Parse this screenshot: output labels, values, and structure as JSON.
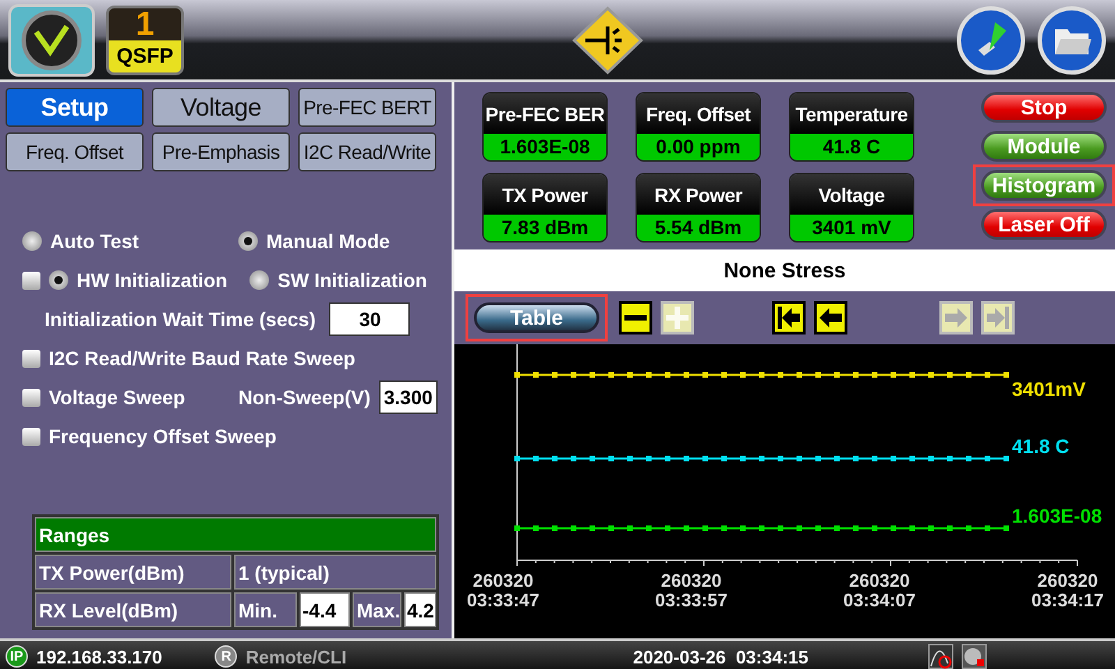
{
  "header": {
    "port_number": "1",
    "port_type": "QSFP"
  },
  "tabs": [
    {
      "label": "Setup",
      "selected": true
    },
    {
      "label": "Voltage",
      "selected": false
    },
    {
      "label": "Pre-FEC BERT",
      "selected": false
    },
    {
      "label": "Freq. Offset",
      "selected": false
    },
    {
      "label": "Pre-Emphasis",
      "selected": false
    },
    {
      "label": "I2C Read/Write",
      "selected": false
    }
  ],
  "mode_options": [
    {
      "label": "Auto Test",
      "selected": false
    },
    {
      "label": "Manual Mode",
      "selected": true
    }
  ],
  "init": {
    "checked": false,
    "options": [
      {
        "label": "HW Initialization",
        "selected": true
      },
      {
        "label": "SW Initialization",
        "selected": false
      }
    ]
  },
  "wait_time": {
    "label": "Initialization Wait Time (secs)",
    "value": "30"
  },
  "sweeps": [
    {
      "label": "I2C Read/Write Baud Rate Sweep",
      "checked": false
    },
    {
      "label": "Voltage Sweep",
      "checked": false
    },
    {
      "label": "Frequency Offset Sweep",
      "checked": false
    }
  ],
  "non_sweep": {
    "label": "Non-Sweep(V)",
    "value": "3.300"
  },
  "ranges": {
    "title": "Ranges",
    "tx_label": "TX Power(dBm)",
    "tx_value": "1 (typical)",
    "rx_label": "RX Level(dBm)",
    "min_label": "Min.",
    "min_value": "-4.4",
    "max_label": "Max.",
    "max_value": "4.2"
  },
  "metrics": [
    {
      "label": "Pre-FEC BER",
      "value": "1.603E-08"
    },
    {
      "label": "Freq. Offset",
      "value": "0.00 ppm"
    },
    {
      "label": "Temperature",
      "value": "41.8 C"
    },
    {
      "label": "TX Power",
      "value": "7.83 dBm"
    },
    {
      "label": "RX Power",
      "value": "5.54 dBm"
    },
    {
      "label": "Voltage",
      "value": "3401 mV"
    }
  ],
  "actions": [
    {
      "label": "Stop",
      "kind": "danger",
      "highlighted": false
    },
    {
      "label": "Module",
      "kind": "normal",
      "highlighted": false
    },
    {
      "label": "Histogram",
      "kind": "normal",
      "highlighted": true
    },
    {
      "label": "Laser Off",
      "kind": "danger",
      "highlighted": false
    }
  ],
  "stress_label": "None Stress",
  "toolbar": {
    "table_button": {
      "label": "Table",
      "highlighted": true
    },
    "buttons": [
      {
        "kind": "minus",
        "disabled": false
      },
      {
        "kind": "plus",
        "disabled": true
      },
      {
        "kind": "first",
        "disabled": false
      },
      {
        "kind": "prev",
        "disabled": false
      },
      {
        "kind": "next",
        "disabled": true
      },
      {
        "kind": "last",
        "disabled": true
      }
    ]
  },
  "chart": {
    "series": [
      {
        "label": "3401mV",
        "color": "#f0e000"
      },
      {
        "label": "41.8 C",
        "color": "#00e0f0"
      },
      {
        "label": "1.603E-08",
        "color": "#00e000"
      }
    ],
    "x_labels": [
      {
        "date": "260320",
        "time": "03:33:47"
      },
      {
        "date": "260320",
        "time": "03:33:57"
      },
      {
        "date": "260320",
        "time": "03:34:07"
      },
      {
        "date": "260320",
        "time": "03:34:17"
      }
    ]
  },
  "status_bar": {
    "ip_badge": "IP",
    "ip": "192.168.33.170",
    "remote_badge": "R",
    "remote": "Remote/CLI",
    "remote_enabled": false,
    "datetime": "2020-03-26  03:34:15"
  }
}
